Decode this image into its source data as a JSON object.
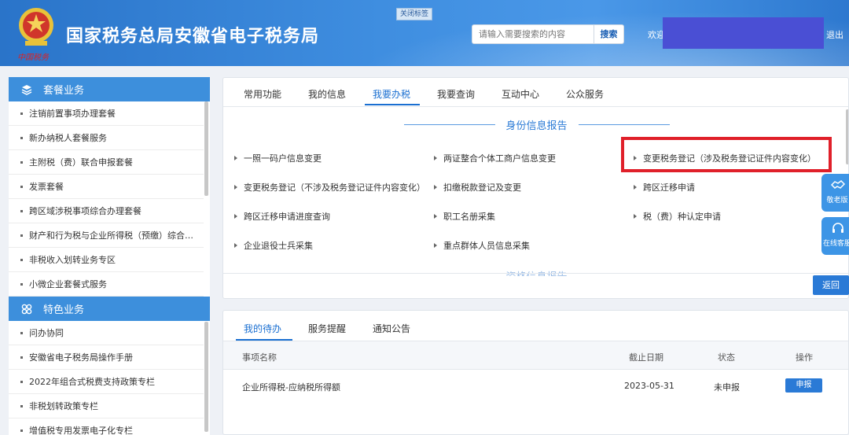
{
  "header": {
    "emblem_caption": "中国税务",
    "site_title": "国家税务总局安徽省电子税务局",
    "close_tag_label": "关闭标签",
    "search_placeholder": "请输入需要搜索的内容",
    "search_label": "搜索",
    "welcome": "欢迎",
    "logout_label": "退出"
  },
  "sidebar": {
    "group1": {
      "title": "套餐业务",
      "items": [
        "注销前置事项办理套餐",
        "新办纳税人套餐服务",
        "主附税（费）联合申报套餐",
        "发票套餐",
        "跨区域涉税事项综合办理套餐",
        "财产和行为税与企业所得税（预缴）综合…",
        "非税收入划转业务专区",
        "小微企业套餐式服务"
      ]
    },
    "group2": {
      "title": "特色业务",
      "items": [
        "问办协同",
        "安徽省电子税务局操作手册",
        "2022年组合式税费支持政策专栏",
        "非税划转政策专栏",
        "增值税专用发票电子化专栏"
      ]
    }
  },
  "main": {
    "tabs": [
      "常用功能",
      "我的信息",
      "我要办税",
      "我要查询",
      "互动中心",
      "公众服务"
    ],
    "active_tab": 2,
    "section_title": "身份信息报告",
    "section_title_next": "资格信息报告",
    "services": [
      "一照一码户信息变更",
      "两证整合个体工商户信息变更",
      "变更税务登记（涉及税务登记证件内容变化）",
      "变更税务登记（不涉及税务登记证件内容变化）",
      "扣缴税款登记及变更",
      "跨区迁移申请",
      "跨区迁移申请进度查询",
      "职工名册采集",
      "税（费）种认定申请",
      "企业退役士兵采集",
      "重点群体人员信息采集"
    ],
    "highlighted_service": 2,
    "back_label": "返回"
  },
  "float": {
    "elder_label": "敬老版",
    "service_label": "在线客服"
  },
  "todo": {
    "tabs": [
      "我的待办",
      "服务提醒",
      "通知公告"
    ],
    "active_tab": 0,
    "columns": [
      "事项名称",
      "截止日期",
      "状态",
      "操作"
    ],
    "rows": [
      {
        "name": "企业所得税-应纳税所得额",
        "deadline": "2023-05-31",
        "status": "未申报",
        "action": "申报"
      }
    ]
  },
  "colors": {
    "header_blue": "#3f8ee0",
    "accent_blue": "#1a6fd1",
    "highlight_red": "#e0202a",
    "redaction": "#4a4fd4"
  }
}
